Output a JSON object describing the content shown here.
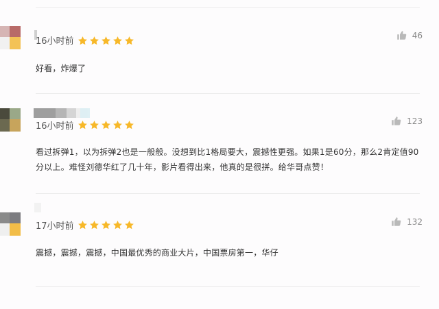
{
  "comments": [
    {
      "time": "16小时前",
      "rating": 5,
      "likes": "46",
      "text": "好看，炸爆了"
    },
    {
      "time": "16小时前",
      "rating": 5,
      "likes": "123",
      "text": "看过拆弹1，以为拆弹2也是一般般。没想到比1格局要大，震撼性更强。如果1是60分，那么2肯定值90分以上。难怪刘德华红了几十年，影片看得出来，他真的是很拼。给华哥点赞！"
    },
    {
      "time": "17小时前",
      "rating": 5,
      "likes": "132",
      "text": "震撼，震撼，震撼，中国最优秀的商业大片，中国票房第一，华仔"
    }
  ],
  "colors": {
    "star": "#f7b829",
    "like_icon": "#b9b9b9",
    "divider": "#ececec"
  }
}
